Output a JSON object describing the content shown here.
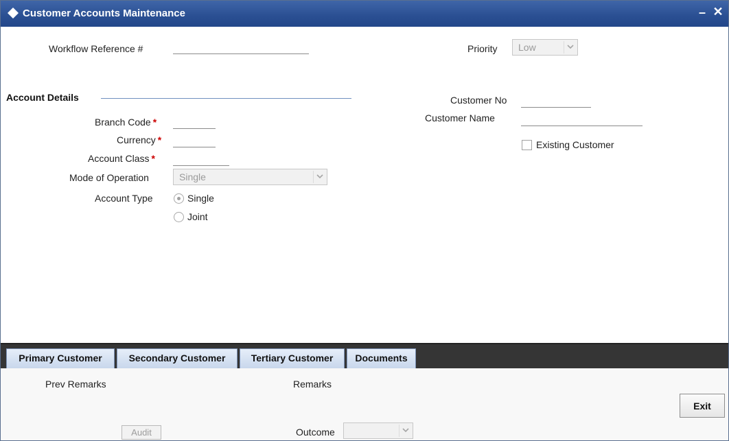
{
  "window": {
    "title": "Customer Accounts Maintenance",
    "minimize_label": "–",
    "close_label": "✕"
  },
  "header": {
    "workflow_ref_label": "Workflow Reference #",
    "workflow_ref_value": "",
    "priority_label": "Priority",
    "priority_value": "Low"
  },
  "account_details": {
    "section_title": "Account Details",
    "branch_code_label": "Branch Code",
    "branch_code_value": "",
    "currency_label": "Currency",
    "currency_value": "",
    "account_class_label": "Account Class",
    "account_class_value": "",
    "required_marker": "*",
    "mode_of_operation_label": "Mode of Operation",
    "mode_of_operation_value": "Single",
    "account_type_label": "Account Type",
    "account_type_options": [
      "Single",
      "Joint"
    ],
    "account_type_selected": "Single"
  },
  "customer": {
    "customer_no_label": "Customer No",
    "customer_no_value": "",
    "customer_name_label": "Customer Name",
    "customer_name_value": "",
    "existing_customer_label": "Existing Customer",
    "existing_customer_checked": false
  },
  "tabs": [
    {
      "label": "Primary Customer"
    },
    {
      "label": "Secondary Customer"
    },
    {
      "label": "Tertiary Customer"
    },
    {
      "label": "Documents"
    }
  ],
  "footer": {
    "prev_remarks_label": "Prev Remarks",
    "remarks_label": "Remarks",
    "audit_label": "Audit",
    "outcome_label": "Outcome",
    "outcome_value": "",
    "exit_label": "Exit"
  },
  "colors": {
    "titlebar": "#2a4f92",
    "tabbar": "#353535",
    "required": "#cc0000"
  }
}
